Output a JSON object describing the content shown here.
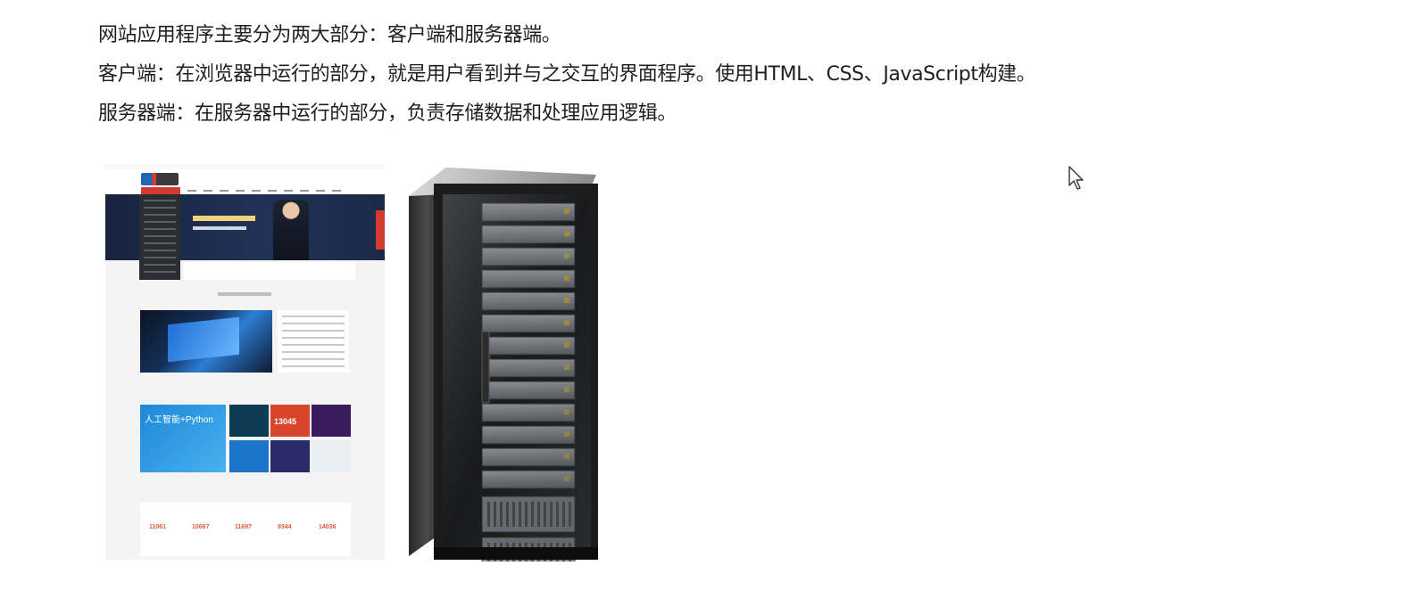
{
  "text": {
    "line1": "网站应用程序主要分为两大部分：客户端和服务器端。",
    "line2": "客户端：在浏览器中运行的部分，就是用户看到并与之交互的界面程序。使用HTML、CSS、JavaScript构建。",
    "line3": "服务器端：在服务器中运行的部分，负责存储数据和处理应用逻辑。"
  },
  "images": {
    "client_image": "website-screenshot",
    "server_image": "server-rack"
  },
  "website_mock": {
    "tile_text": "人工智能+Python",
    "tile_number": "13045",
    "stat_values": [
      "11061",
      "10667",
      "11697",
      "9344",
      "14036"
    ]
  },
  "colors": {
    "text": "#1f1f1f",
    "brand_red": "#d23b2f",
    "banner_navy": "#1b2a48"
  }
}
